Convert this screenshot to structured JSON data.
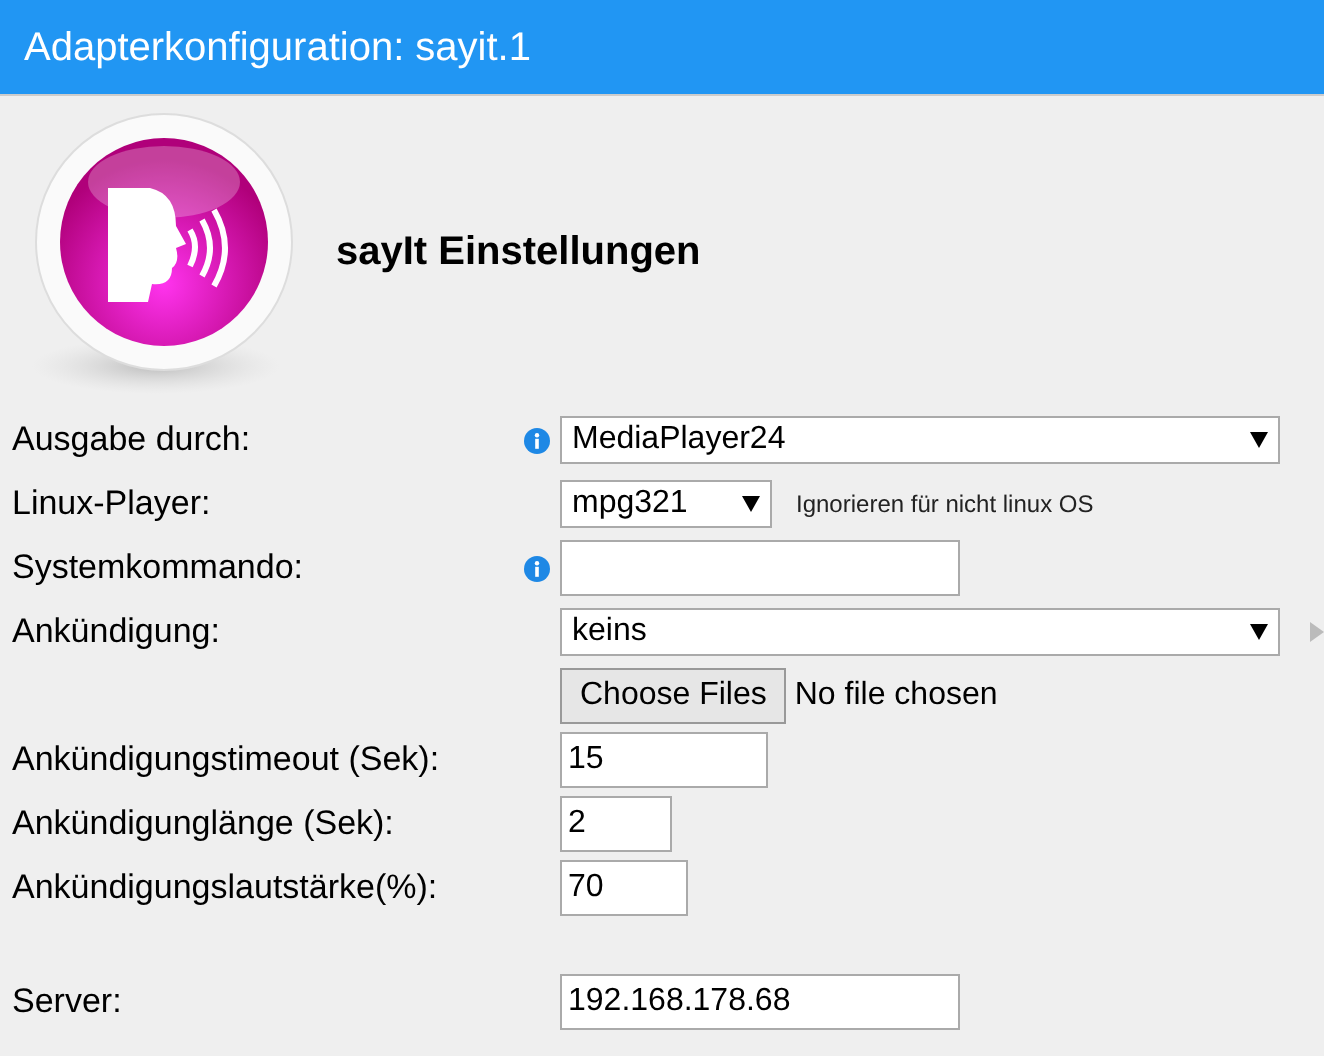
{
  "window": {
    "title": "Adapterkonfiguration: sayit.1"
  },
  "heading": "sayIt Einstellungen",
  "rows": [
    {
      "kind": "select",
      "label": "Ausgabe durch:",
      "info": true,
      "value": "MediaPlayer24"
    },
    {
      "kind": "select",
      "label": "Linux-Player:",
      "info": false,
      "value": "mpg321",
      "note": "Ignorieren für nicht linux OS"
    },
    {
      "kind": "text",
      "label": "Systemkommando:",
      "info": true
    },
    {
      "kind": "select",
      "label": "Ankündigung:",
      "info": false,
      "value": "keins",
      "side_arrow": true
    },
    {
      "kind": "file",
      "button": "Choose Files",
      "status": "No file chosen"
    },
    {
      "kind": "text",
      "label": "Ankündigungstimeout (Sek):",
      "info": false,
      "value": "15"
    },
    {
      "kind": "text",
      "label": "Ankündigunglänge (Sek):",
      "info": false,
      "value": "2"
    },
    {
      "kind": "text",
      "label": "Ankündigungslautstärke(%):",
      "info": false,
      "value": "70"
    },
    {
      "kind": "text",
      "label": "Server:",
      "info": false,
      "value": "192.168.178.68"
    }
  ]
}
